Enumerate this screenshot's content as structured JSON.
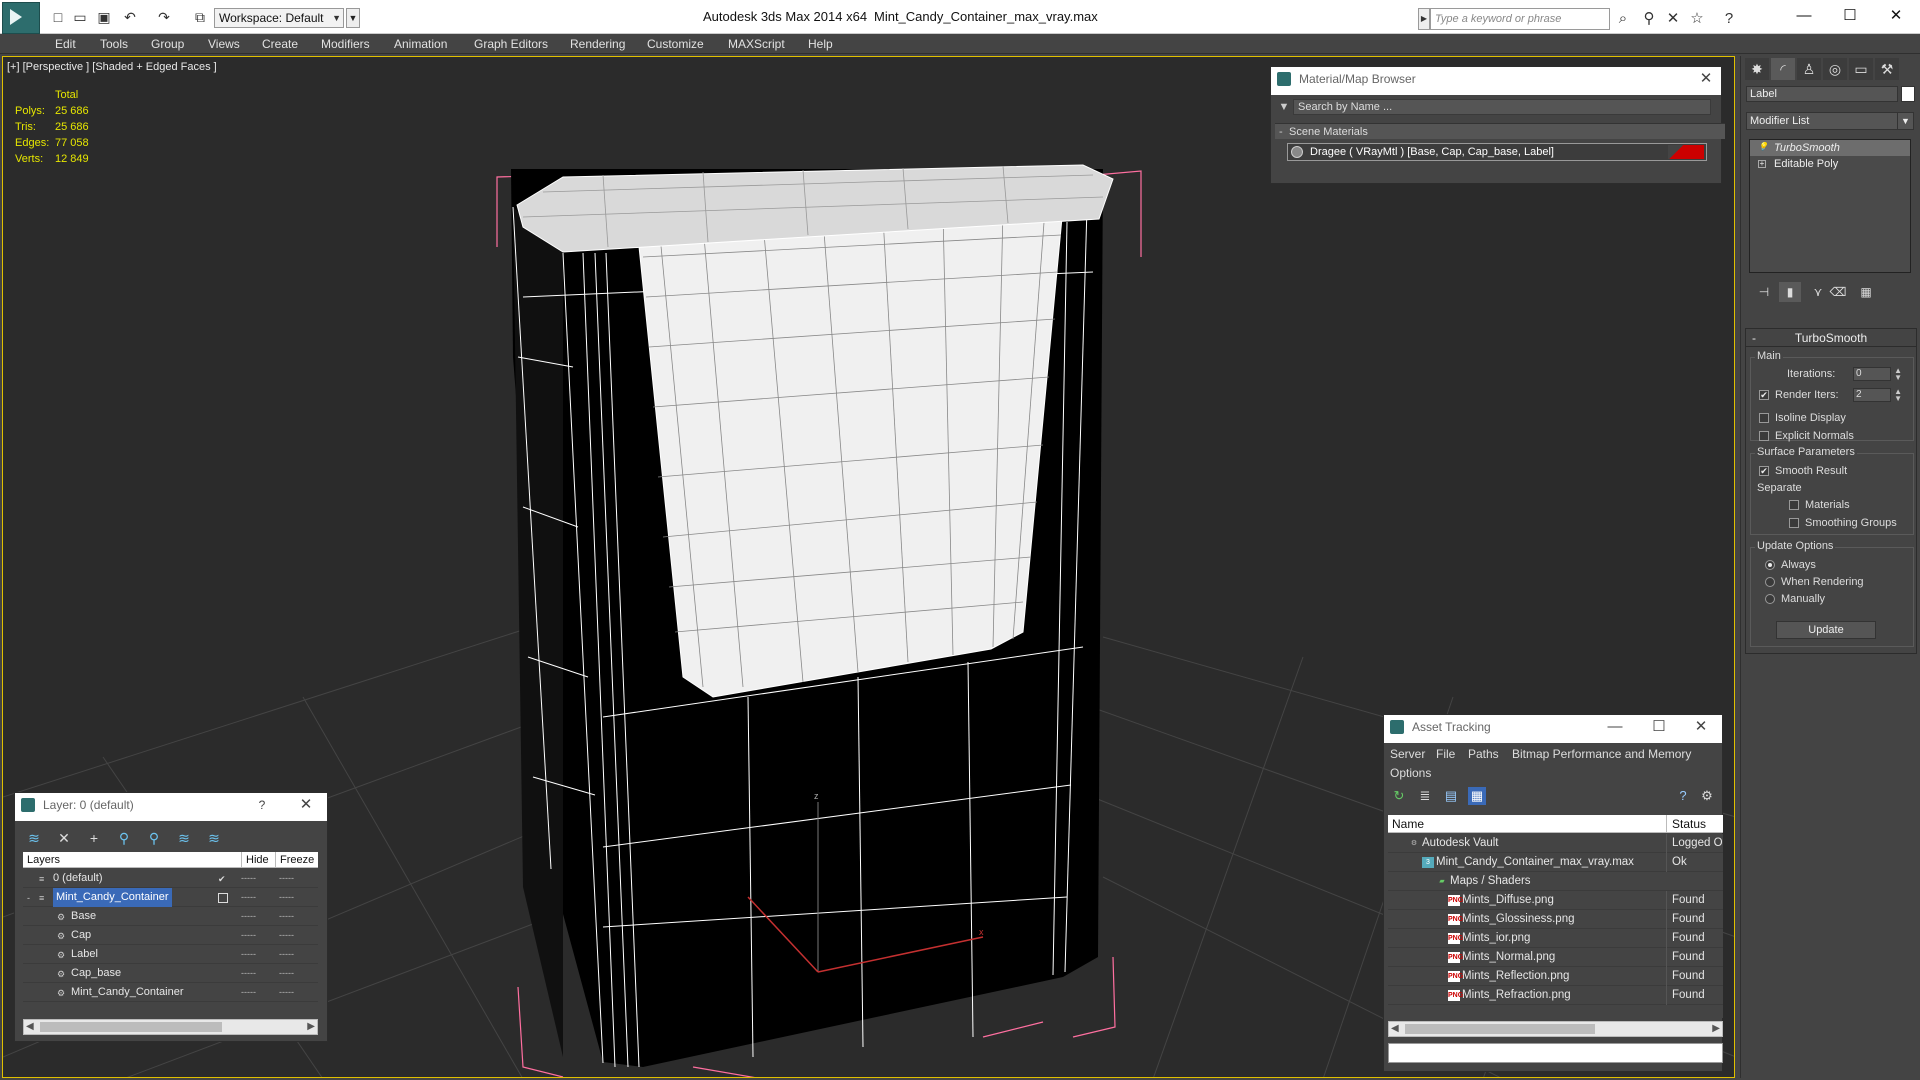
{
  "titlebar": {
    "workspace": "Workspace: Default",
    "app_title": "Autodesk 3ds Max  2014 x64",
    "file_title": "Mint_Candy_Container_max_vray.max",
    "search_placeholder": "Type a keyword or phrase"
  },
  "menu": [
    "Edit",
    "Tools",
    "Group",
    "Views",
    "Create",
    "Modifiers",
    "Animation",
    "Graph Editors",
    "Rendering",
    "Customize",
    "MAXScript",
    "Help"
  ],
  "viewport": {
    "label": "[+] [Perspective ] [Shaded + Edged Faces ]",
    "stats_header": "Total",
    "stats": [
      {
        "k": "Polys:",
        "v": "25 686"
      },
      {
        "k": "Tris:",
        "v": "25 686"
      },
      {
        "k": "Edges:",
        "v": "77 058"
      },
      {
        "k": "Verts:",
        "v": "12 849"
      }
    ],
    "axis_x": "x",
    "axis_z": "z"
  },
  "material_browser": {
    "title": "Material/Map Browser",
    "search": "Search by Name ...",
    "group": "Scene Materials",
    "item": "Dragee  ( VRayMtl )  [Base, Cap, Cap_base, Label]"
  },
  "command_panel": {
    "name": "Label",
    "modifier_list": "Modifier List",
    "stack": [
      "TurboSmooth",
      "Editable Poly"
    ],
    "rollout_title": "TurboSmooth",
    "main_label": "Main",
    "iterations_label": "Iterations:",
    "iterations_value": "0",
    "render_iters_label": "Render Iters:",
    "render_iters_value": "2",
    "isoline": "Isoline Display",
    "explicit_normals": "Explicit Normals",
    "surface_params": "Surface Parameters",
    "smooth_result": "Smooth Result",
    "separate": "Separate",
    "materials": "Materials",
    "smoothing_groups": "Smoothing Groups",
    "update_options": "Update Options",
    "always": "Always",
    "when_rendering": "When Rendering",
    "manually": "Manually",
    "update_button": "Update"
  },
  "layer_window": {
    "title": "Layer: 0 (default)",
    "help": "?",
    "col_layers": "Layers",
    "col_hide": "Hide",
    "col_freeze": "Freeze",
    "rows": [
      {
        "name": "0 (default)",
        "indent": 0
      },
      {
        "name": "Mint_Candy_Container",
        "indent": 0
      },
      {
        "name": "Base",
        "indent": 1
      },
      {
        "name": "Cap",
        "indent": 1
      },
      {
        "name": "Label",
        "indent": 1
      },
      {
        "name": "Cap_base",
        "indent": 1
      },
      {
        "name": "Mint_Candy_Container",
        "indent": 1
      }
    ],
    "hide_marker": "-----",
    "freeze_marker": "-----"
  },
  "asset_tracking": {
    "title": "Asset Tracking",
    "menu": [
      "Server",
      "File",
      "Paths",
      "Bitmap Performance and Memory",
      "Options"
    ],
    "col_name": "Name",
    "col_status": "Status",
    "rows": [
      {
        "name": "Autodesk Vault",
        "status": "Logged Out"
      },
      {
        "name": "Mint_Candy_Container_max_vray.max",
        "status": "Ok"
      },
      {
        "name": "Maps / Shaders",
        "status": ""
      },
      {
        "name": "Mints_Diffuse.png",
        "status": "Found"
      },
      {
        "name": "Mints_Glossiness.png",
        "status": "Found"
      },
      {
        "name": "Mints_ior.png",
        "status": "Found"
      },
      {
        "name": "Mints_Normal.png",
        "status": "Found"
      },
      {
        "name": "Mints_Reflection.png",
        "status": "Found"
      },
      {
        "name": "Mints_Refraction.png",
        "status": "Found"
      }
    ],
    "png_badge": "PNG"
  },
  "colors": {
    "viewport_bg": "#2b2b2b",
    "active_border": "#e0c000",
    "selection_blue": "#3a6ab8",
    "stats_yellow": "#e6e600",
    "wire_white": "#ffffff",
    "bbox_pink": "#ff6fa0"
  }
}
